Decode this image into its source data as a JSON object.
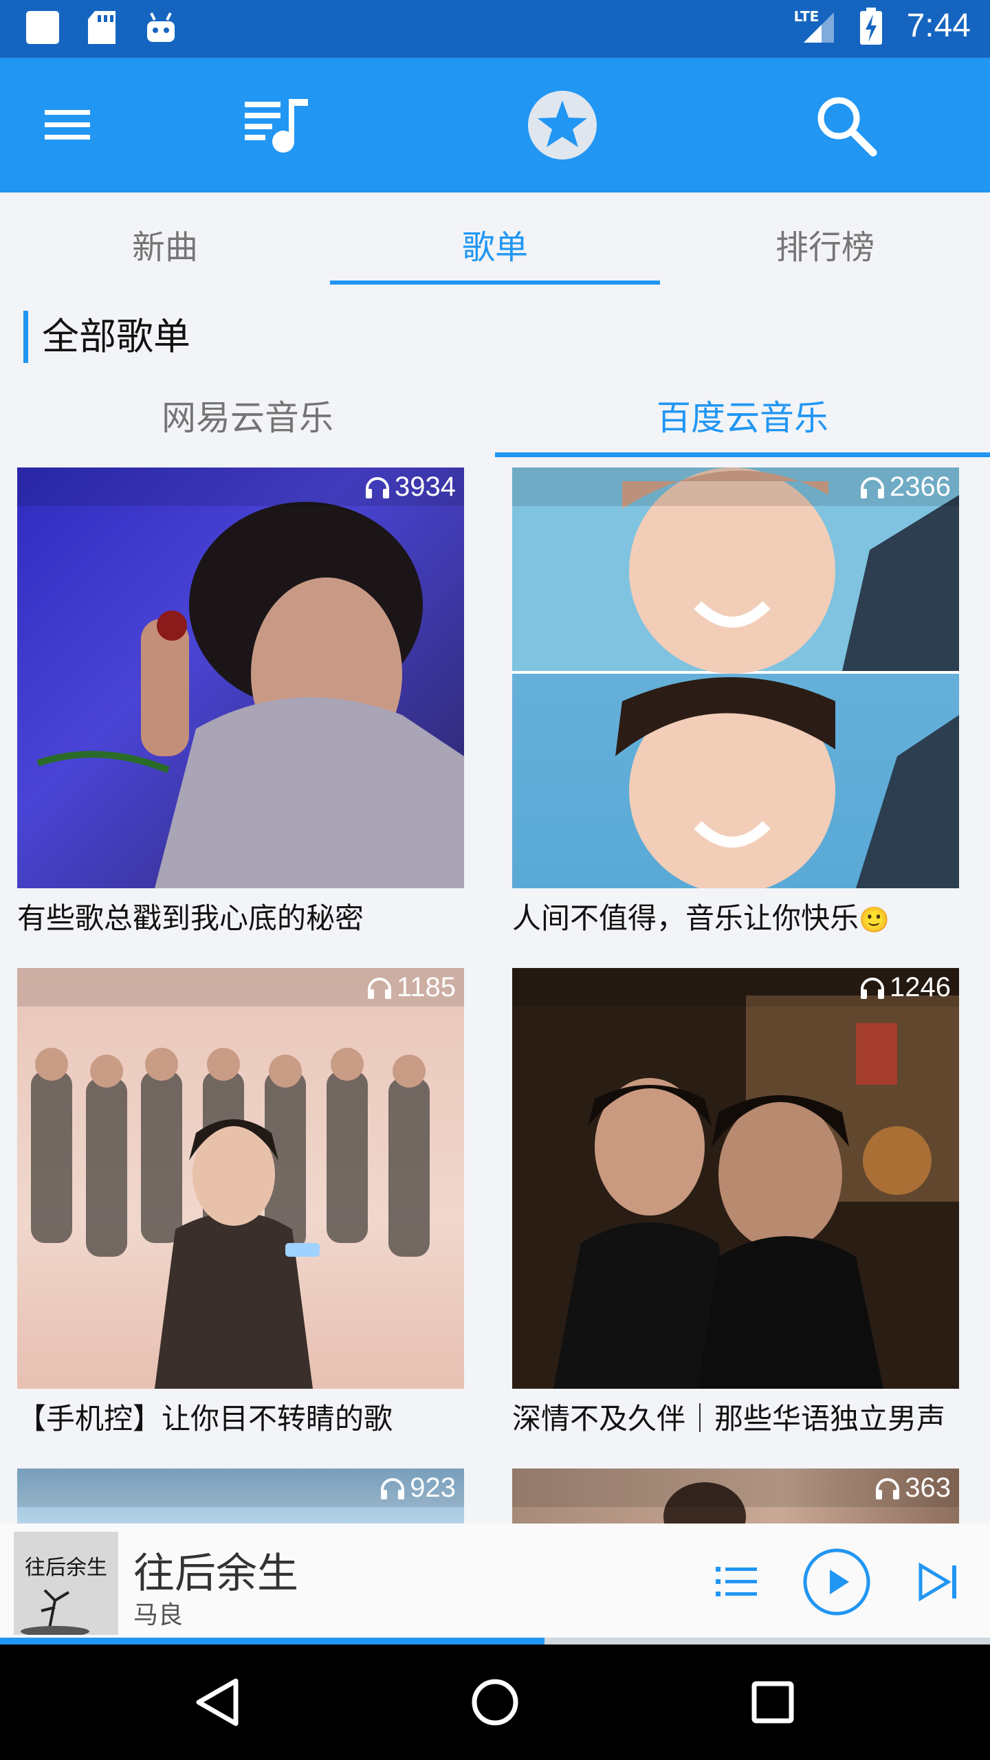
{
  "status_bar": {
    "time": "7:44",
    "network": "LTE",
    "icons": [
      "square-notification-icon",
      "sd-card-icon",
      "android-icon",
      "signal-icon",
      "battery-charging-icon"
    ]
  },
  "toolbar": {
    "icons": [
      "menu-icon",
      "playlist-music-icon",
      "favorite-star-icon",
      "search-icon"
    ]
  },
  "main_tabs": [
    {
      "label": "新曲",
      "active": false
    },
    {
      "label": "歌单",
      "active": true
    },
    {
      "label": "排行榜",
      "active": false
    }
  ],
  "section": {
    "title": "全部歌单"
  },
  "source_tabs": [
    {
      "label": "网易云音乐",
      "active": false
    },
    {
      "label": "百度云音乐",
      "active": true
    }
  ],
  "playlists": [
    {
      "count": "3934",
      "title": "有些歌总戳到我心底的秘密",
      "cover_color": "#3b36c9"
    },
    {
      "count": "2366",
      "title": "人间不值得，音乐让你快乐",
      "emoji": "🙂",
      "cover_color": "#6fb7dd"
    },
    {
      "count": "1185",
      "title": "【手机控】让你目不转睛的歌",
      "cover_color": "#e8c3b6"
    },
    {
      "count": "1246",
      "title": "深情不及久伴｜那些华语独立男声",
      "cover_color": "#3a2a1f"
    },
    {
      "count": "923",
      "title": "",
      "cover_color": "#9fc6e2"
    },
    {
      "count": "363",
      "title": "",
      "cover_color": "#b89a86"
    }
  ],
  "player": {
    "album_art_text": "往后余生",
    "song_title": "往后余生",
    "artist": "马良",
    "progress": 0.55
  },
  "nav_bar": {
    "icons": [
      "back-triangle-icon",
      "home-circle-icon",
      "recents-square-icon"
    ]
  },
  "colors": {
    "status_bar": "#1565c0",
    "toolbar": "#2196f3",
    "accent": "#2196f3",
    "background": "#f2f4f7"
  }
}
